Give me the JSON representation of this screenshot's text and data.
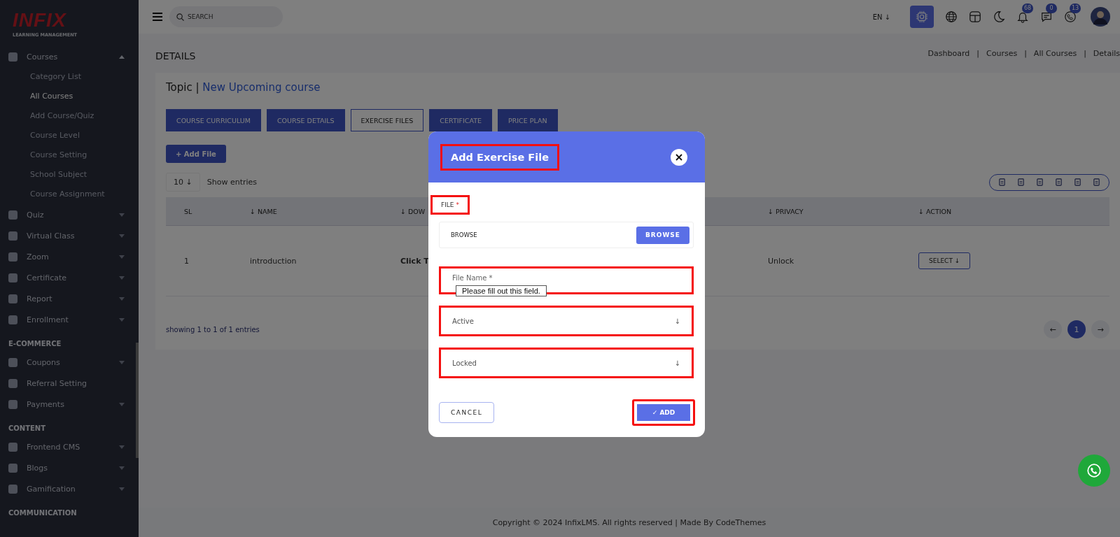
{
  "logo": {
    "title": "INFIX",
    "subtitle": "LEARNING MANAGEMENT"
  },
  "sidebar": {
    "sections": [
      {
        "items": [
          {
            "label": "Courses",
            "caret": true,
            "expanded": true,
            "children": [
              {
                "label": "Category List",
                "selected": false
              },
              {
                "label": "All Courses",
                "selected": true
              },
              {
                "label": "Add Course/Quiz",
                "selected": false
              },
              {
                "label": "Course Level",
                "selected": false
              },
              {
                "label": "Course Setting",
                "selected": false
              },
              {
                "label": "School Subject",
                "selected": false
              },
              {
                "label": "Course Assignment",
                "selected": false
              }
            ]
          },
          {
            "label": "Quiz",
            "caret": true,
            "expanded": false
          },
          {
            "label": "Virtual Class",
            "caret": true,
            "expanded": false
          },
          {
            "label": "Zoom",
            "caret": true,
            "expanded": false
          },
          {
            "label": "Certificate",
            "caret": true,
            "expanded": false
          },
          {
            "label": "Report",
            "caret": true,
            "expanded": false
          },
          {
            "label": "Enrollment",
            "caret": true,
            "expanded": false
          }
        ]
      },
      {
        "heading": "E-COMMERCE",
        "items": [
          {
            "label": "Coupons",
            "caret": true,
            "expanded": false
          },
          {
            "label": "Referral Setting",
            "caret": false
          },
          {
            "label": "Payments",
            "caret": true,
            "expanded": false
          }
        ]
      },
      {
        "heading": "CONTENT",
        "items": [
          {
            "label": "Frontend CMS",
            "caret": true,
            "expanded": false
          },
          {
            "label": "Blogs",
            "caret": true,
            "expanded": false
          },
          {
            "label": "Gamification",
            "caret": true,
            "expanded": false
          }
        ]
      },
      {
        "heading": "COMMUNICATION"
      }
    ]
  },
  "topbar": {
    "search": {
      "placeholder": "SEARCH"
    },
    "language": "EN ↓",
    "badges": [
      {
        "kind": "bell",
        "count": "68"
      },
      {
        "kind": "chat",
        "count": "0"
      },
      {
        "kind": "phone",
        "count": "13"
      }
    ]
  },
  "page_title": "DETAILS",
  "breadcrumb": {
    "separator": "|",
    "items": [
      "Dashboard",
      "Courses",
      "All Courses",
      "Details"
    ]
  },
  "topic": {
    "label": "Topic |",
    "name": "New Upcoming course"
  },
  "tabs": [
    {
      "label": "COURSE CURRICULUM",
      "selected": false
    },
    {
      "label": "COURSE DETAILS",
      "selected": false
    },
    {
      "label": "EXERCISE FILES",
      "selected": true
    },
    {
      "label": "CERTIFICATE",
      "selected": false
    },
    {
      "label": "PRICE PLAN",
      "selected": false
    }
  ],
  "add_button": "+ Add File",
  "entries": {
    "value": "10 ↓",
    "label": "Show entries"
  },
  "table": {
    "columns": [
      "SL",
      "↓ NAME",
      "↓ DOW",
      "↓ PRIVACY",
      "↓ ACTION"
    ],
    "rows": [
      {
        "sl": "1",
        "name": "introduction",
        "download": "Click T",
        "privacy": "Unlock",
        "action": "SELECT ↓"
      }
    ]
  },
  "table_info": "showing 1 to 1 of 1 entries",
  "pagination": {
    "prev": "←",
    "pages": [
      {
        "label": "1",
        "selected": true
      }
    ],
    "next": "→"
  },
  "footer": "Copyright © 2024 InfixLMS. All rights reserved | Made By CodeThemes",
  "modal": {
    "title": "Add Exercise File",
    "title_highlighted": true,
    "file": {
      "label": "FILE",
      "required": "*",
      "highlighted": true,
      "value": "BROWSE",
      "button": "BROWSE"
    },
    "file_name": {
      "placeholder": "File Name *",
      "highlighted": true,
      "tooltip": "Please fill out this field."
    },
    "selects": [
      {
        "value": "Active",
        "arrow": "↓",
        "highlighted": true
      },
      {
        "value": "Locked",
        "arrow": "↓",
        "highlighted": true
      }
    ],
    "cancel": "CANCEL",
    "add": {
      "label": "✓ ADD",
      "highlighted": true
    }
  }
}
